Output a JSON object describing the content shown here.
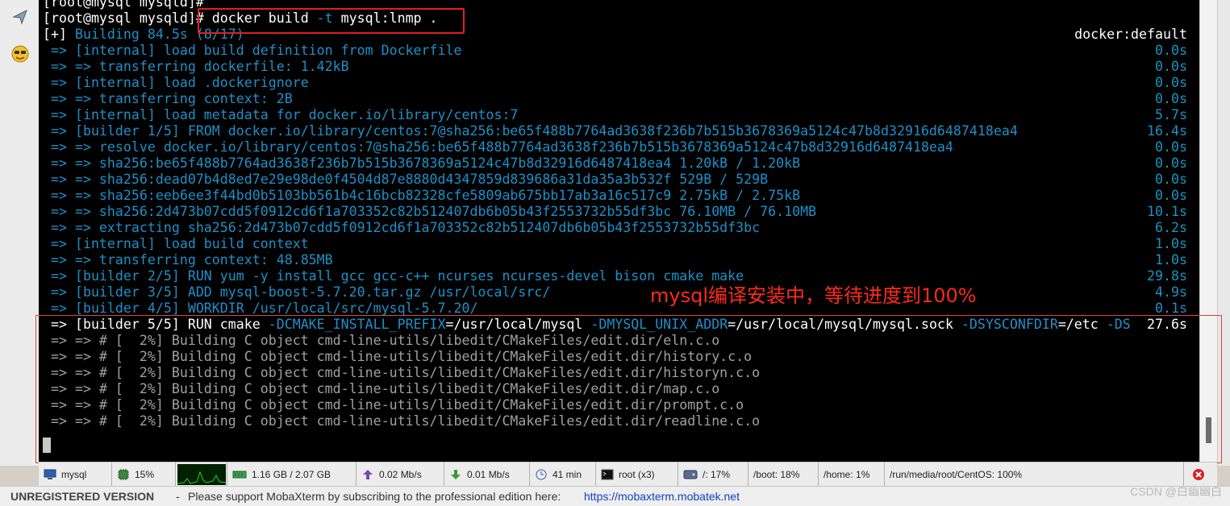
{
  "terminal": {
    "lines": [
      {
        "segs": [
          {
            "c": "w",
            "t": "[root@mysql mysqld]# "
          }
        ],
        "right": ""
      },
      {
        "segs": [
          {
            "c": "w",
            "t": "[root@mysql mysqld]# docker build "
          },
          {
            "c": "b",
            "t": "-t"
          },
          {
            "c": "w",
            "t": " mysql:lnmp ."
          }
        ],
        "right": ""
      },
      {
        "segs": [
          {
            "c": "w",
            "t": "[+] "
          },
          {
            "c": "b",
            "t": "Building 84.5s (8/17)"
          }
        ],
        "right": "docker:default",
        "rc": "w"
      },
      {
        "segs": [
          {
            "c": "b",
            "t": " => [internal] load build definition from Dockerfile"
          }
        ],
        "right": "0.0s",
        "rc": "b"
      },
      {
        "segs": [
          {
            "c": "b",
            "t": " => => transferring dockerfile: 1.42kB"
          }
        ],
        "right": "0.0s",
        "rc": "b"
      },
      {
        "segs": [
          {
            "c": "b",
            "t": " => [internal] load .dockerignore"
          }
        ],
        "right": "0.0s",
        "rc": "b"
      },
      {
        "segs": [
          {
            "c": "b",
            "t": " => => transferring context: 2B"
          }
        ],
        "right": "0.0s",
        "rc": "b"
      },
      {
        "segs": [
          {
            "c": "b",
            "t": " => [internal] load metadata for docker.io/library/centos:7"
          }
        ],
        "right": "5.7s",
        "rc": "b"
      },
      {
        "segs": [
          {
            "c": "b",
            "t": " => [builder 1/5] FROM docker.io/library/centos:7@sha256:be65f488b7764ad3638f236b7b515b3678369a5124c47b8d32916d6487418ea4"
          }
        ],
        "right": "16.4s",
        "rc": "b"
      },
      {
        "segs": [
          {
            "c": "b",
            "t": " => => resolve docker.io/library/centos:7@sha256:be65f488b7764ad3638f236b7b515b3678369a5124c47b8d32916d6487418ea4"
          }
        ],
        "right": "0.0s",
        "rc": "b"
      },
      {
        "segs": [
          {
            "c": "b",
            "t": " => => sha256:be65f488b7764ad3638f236b7b515b3678369a5124c47b8d32916d6487418ea4 1.20kB / 1.20kB"
          }
        ],
        "right": "0.0s",
        "rc": "b"
      },
      {
        "segs": [
          {
            "c": "b",
            "t": " => => sha256:dead07b4d8ed7e29e98de0f4504d87e8880d4347859d839686a31da35a3b532f 529B / 529B"
          }
        ],
        "right": "0.0s",
        "rc": "b"
      },
      {
        "segs": [
          {
            "c": "b",
            "t": " => => sha256:eeb6ee3f44bd0b5103bb561b4c16bcb82328cfe5809ab675bb17ab3a16c517c9 2.75kB / 2.75kB"
          }
        ],
        "right": "0.0s",
        "rc": "b"
      },
      {
        "segs": [
          {
            "c": "b",
            "t": " => => sha256:2d473b07cdd5f0912cd6f1a703352c82b512407db6b05b43f2553732b55df3bc 76.10MB / 76.10MB"
          }
        ],
        "right": "10.1s",
        "rc": "b"
      },
      {
        "segs": [
          {
            "c": "b",
            "t": " => => extracting sha256:2d473b07cdd5f0912cd6f1a703352c82b512407db6b05b43f2553732b55df3bc"
          }
        ],
        "right": "6.2s",
        "rc": "b"
      },
      {
        "segs": [
          {
            "c": "b",
            "t": " => [internal] load build context"
          }
        ],
        "right": "1.0s",
        "rc": "b"
      },
      {
        "segs": [
          {
            "c": "b",
            "t": " => => transferring context: 48.85MB"
          }
        ],
        "right": "1.0s",
        "rc": "b"
      },
      {
        "segs": [
          {
            "c": "b",
            "t": " => [builder 2/5] RUN yum -y install gcc gcc-c++ ncurses ncurses-devel bison cmake make"
          }
        ],
        "right": "29.8s",
        "rc": "b"
      },
      {
        "segs": [
          {
            "c": "b",
            "t": " => [builder 3/5] ADD mysql-boost-5.7.20.tar.gz /usr/local/src/"
          }
        ],
        "right": "4.9s",
        "rc": "b"
      },
      {
        "segs": [
          {
            "c": "b",
            "t": " => [builder 4/5] WORKDIR /usr/local/src/mysql-5.7.20/"
          }
        ],
        "right": "0.1s",
        "rc": "b"
      },
      {
        "segs": [
          {
            "c": "w",
            "t": " => [builder 5/5] RUN cmake "
          },
          {
            "c": "b",
            "t": "-DCMAKE_INSTALL_PREFIX"
          },
          {
            "c": "w",
            "t": "=/usr/local/mysql "
          },
          {
            "c": "b",
            "t": "-DMYSQL_UNIX_ADDR"
          },
          {
            "c": "w",
            "t": "=/usr/local/mysql/mysql.sock "
          },
          {
            "c": "b",
            "t": "-DSYSCONFDIR"
          },
          {
            "c": "w",
            "t": "=/etc "
          },
          {
            "c": "b",
            "t": "-DS"
          }
        ],
        "right": "27.6s",
        "rc": "w"
      },
      {
        "segs": [
          {
            "c": "g",
            "t": " => => # [  2%] Building C object cmd-line-utils/libedit/CMakeFiles/edit.dir/eln.c.o"
          }
        ],
        "right": ""
      },
      {
        "segs": [
          {
            "c": "g",
            "t": " => => # [  2%] Building C object cmd-line-utils/libedit/CMakeFiles/edit.dir/history.c.o"
          }
        ],
        "right": ""
      },
      {
        "segs": [
          {
            "c": "g",
            "t": " => => # [  2%] Building C object cmd-line-utils/libedit/CMakeFiles/edit.dir/historyn.c.o"
          }
        ],
        "right": ""
      },
      {
        "segs": [
          {
            "c": "g",
            "t": " => => # [  2%] Building C object cmd-line-utils/libedit/CMakeFiles/edit.dir/map.c.o"
          }
        ],
        "right": ""
      },
      {
        "segs": [
          {
            "c": "g",
            "t": " => => # [  2%] Building C object cmd-line-utils/libedit/CMakeFiles/edit.dir/prompt.c.o"
          }
        ],
        "right": ""
      },
      {
        "segs": [
          {
            "c": "g",
            "t": " => => # [  2%] Building C object cmd-line-utils/libedit/CMakeFiles/edit.dir/readline.c.o"
          }
        ],
        "right": ""
      }
    ]
  },
  "annotation": "mysql编译安装中，等待进度到100%",
  "status_bar": {
    "session": "mysql",
    "cpu": "15%",
    "memory": "1.16 GB / 2.07 GB",
    "upload": "0.02 Mb/s",
    "download": "0.01 Mb/s",
    "uptime": "41 min",
    "users": "root (x3)",
    "disk_root": "/: 17%",
    "disk_boot": "/boot: 18%",
    "disk_home": "/home: 1%",
    "disk_media": "/run/media/root/CentOS: 100%"
  },
  "bottom_bar": {
    "unregistered": "UNREGISTERED VERSION",
    "separator": "-",
    "message": "Please support MobaXterm by subscribing to the professional edition here:",
    "link": "https://mobaxterm.mobatek.net"
  },
  "watermark": "CSDN @白幽幽白",
  "colors": {
    "terminal_bg": "#000000",
    "text_white": "#ffffff",
    "text_blue": "#1e90c8",
    "text_gray": "#a0a0a0",
    "annotation_red": "#ff2a1a"
  }
}
